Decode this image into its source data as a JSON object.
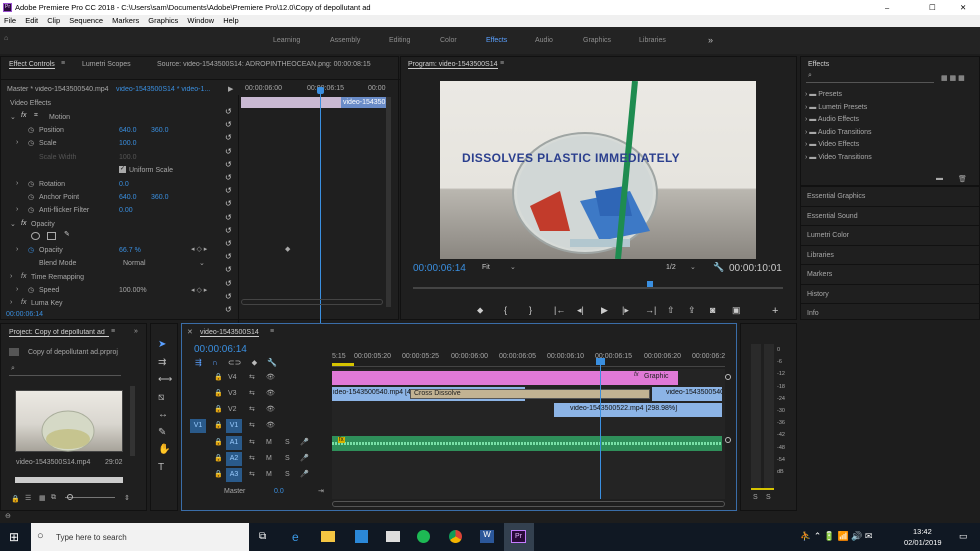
{
  "window": {
    "title": "Adobe Premiere Pro CC 2018 - C:\\Users\\sam\\Documents\\Adobe\\Premiere Pro\\12.0\\Copy of depollutant ad",
    "controls": [
      "–",
      "☐",
      "✕"
    ]
  },
  "menu": [
    "File",
    "Edit",
    "Clip",
    "Sequence",
    "Markers",
    "Graphics",
    "Window",
    "Help"
  ],
  "workspaces": [
    "Learning",
    "Assembly",
    "Editing",
    "Color",
    "Effects",
    "Audio",
    "Graphics",
    "Libraries"
  ],
  "effect_controls": {
    "tab": "Effect Controls",
    "tab2": "Lumetri Scopes",
    "source": "Source: video-1543500S14: ADROPINTHEOCEAN.png: 00:00:08:15",
    "master": "Master * video-1543500540.mp4",
    "clip": "video-1543500S14 * video-1...",
    "times": [
      "00:00:06:00",
      "00:00:06:15",
      "00:00"
    ],
    "clip_bar": "video-154350",
    "section": "Video Effects",
    "motion": "Motion",
    "rows": [
      {
        "label": "Position",
        "v1": "640.0",
        "v2": "360.0"
      },
      {
        "label": "Scale",
        "v1": "100.0"
      },
      {
        "label": "Scale Width",
        "v1": "100.0"
      },
      {
        "label": "Uniform Scale"
      },
      {
        "label": "Rotation",
        "v1": "0.0"
      },
      {
        "label": "Anchor Point",
        "v1": "640.0",
        "v2": "360.0"
      },
      {
        "label": "Anti-flicker Filter",
        "v1": "0.00"
      }
    ],
    "opacity": "Opacity",
    "opacity_label": "Opacity",
    "opacity_value": "66.7 %",
    "blend_label": "Blend Mode",
    "blend_value": "Normal",
    "time_remap": "Time Remapping",
    "speed_label": "Speed",
    "speed_value": "100.00%",
    "luma": "Luma Key",
    "timecode": "00:00:06:14"
  },
  "program": {
    "tab": "Program: video-1543500S14",
    "overlay_text": "DISSOLVES PLASTIC IMMEDIATELY",
    "timecode": "00:00:06:14",
    "fit": "Fit",
    "ratio": "1/2",
    "duration": "00:00:10:01"
  },
  "effects_panel": {
    "title": "Effects",
    "items": [
      "Presets",
      "Lumetri Presets",
      "Audio Effects",
      "Audio Transitions",
      "Video Effects",
      "Video Transitions"
    ],
    "sections": [
      "Essential Graphics",
      "Essential Sound",
      "Lumetri Color",
      "Libraries",
      "Markers",
      "History",
      "Info"
    ]
  },
  "project": {
    "tab": "Project: Copy of depollutant ad",
    "file": "Copy of depollutant ad.prproj",
    "clip_name": "video-1543500S14.mp4",
    "clip_dur": "29:02"
  },
  "timeline": {
    "tab": "video-1543500S14",
    "timecode": "00:00:06:14",
    "ruler": [
      "5:15",
      "00:00:05:20",
      "00:00:05:25",
      "00:00:06:00",
      "00:00:06:05",
      "00:00:06:10",
      "00:00:06:15",
      "00:00:06:20",
      "00:00:06:2"
    ],
    "video_tracks": [
      "V4",
      "V3",
      "V2",
      "V1"
    ],
    "audio_tracks": [
      "A1",
      "A2",
      "A3"
    ],
    "master": "Master",
    "master_val": "0.0",
    "clips": {
      "graphic": "Graphic",
      "v3a": "ideo-1543500540.mp4 [400%]",
      "cross": "Cross Dissolve",
      "v3b": "video-1543500540.",
      "v2": "video-1543500522.mp4 [298.98%]"
    }
  },
  "meter": {
    "labels": [
      "0",
      "-6",
      "-12",
      "-18",
      "-24",
      "-30",
      "-36",
      "-42",
      "-48",
      "-54",
      "dB"
    ],
    "solo": [
      "S",
      "S"
    ]
  },
  "taskbar": {
    "search": "Type here to search",
    "time": "13:42",
    "date": "02/01/2019"
  }
}
